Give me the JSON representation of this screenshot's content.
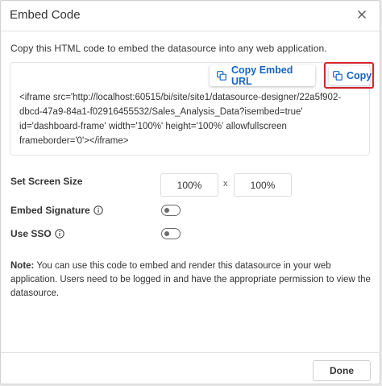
{
  "dialog": {
    "title": "Embed Code",
    "description": "Copy this HTML code to embed the datasource into any web application.",
    "copy_embed_url_label": "Copy Embed URL",
    "copy_label": "Copy",
    "embed_code": "<iframe src='http://localhost:60515/bi/site/site1/datasource-designer/22a5f902-dbcd-47a9-84a1-f02916455532/Sales_Analysis_Data?isembed=true' id='dashboard-frame'  width='100%' height='100%' allowfullscreen frameborder='0'></iframe>",
    "screen_size": {
      "label": "Set Screen Size",
      "width": "100%",
      "separator": "x",
      "height": "100%"
    },
    "embed_signature": {
      "label": "Embed Signature",
      "enabled": false
    },
    "use_sso": {
      "label": "Use SSO",
      "enabled": false
    },
    "note": {
      "prefix": "Note:",
      "text": " You can use this code to embed and render this datasource in your web application. Users need to be logged in and have the appropriate permission to view the datasource."
    },
    "done_label": "Done"
  },
  "colors": {
    "accent": "#1565c0",
    "highlight": "#d3262c"
  },
  "icons": {
    "close": "close-icon",
    "copy": "copy-icon",
    "info": "info-icon"
  }
}
